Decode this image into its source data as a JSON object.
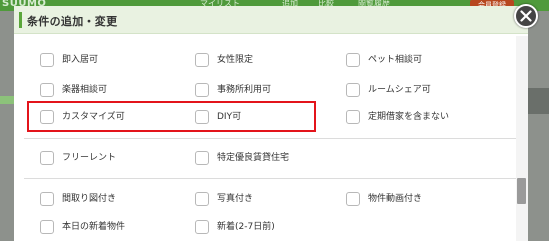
{
  "background": {
    "logo": "SUUMO",
    "nav_items": [
      "マイリスト",
      "追加",
      "比較",
      "閲覧履歴"
    ],
    "join_button": "会員登録"
  },
  "modal": {
    "title": "条件の追加・変更",
    "close_label": "×",
    "options": [
      {
        "label": "即入居可"
      },
      {
        "label": "女性限定"
      },
      {
        "label": "ペット相談可"
      },
      {
        "label": "楽器相談可"
      },
      {
        "label": "事務所利用可"
      },
      {
        "label": "ルームシェア可"
      },
      {
        "label": "カスタマイズ可"
      },
      {
        "label": "DIY可"
      },
      {
        "label": "定期借家を含まない"
      },
      {
        "label": "フリーレント"
      },
      {
        "label": "特定優良賃貸住宅"
      },
      {
        "label": "間取り図付き"
      },
      {
        "label": "写真付き"
      },
      {
        "label": "物件動画付き"
      },
      {
        "label": "本日の新着物件"
      },
      {
        "label": "新着(2-7日前)"
      }
    ]
  },
  "colors": {
    "accent_green": "#5aa63a",
    "header_bg": "#e9f2e1",
    "highlight_red": "#e3141b",
    "site_header": "#4f9a3b"
  }
}
